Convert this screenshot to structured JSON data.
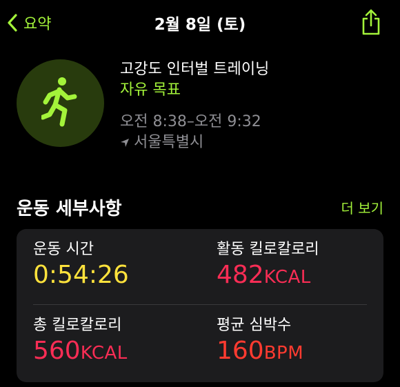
{
  "nav": {
    "back_label": "요약",
    "title": "2월 8일 (토)"
  },
  "workout": {
    "type": "고강도 인터벌 트레이닝",
    "goal": "자유 목표",
    "time_range": "오전 8:38–오전 9:32",
    "location": "서울특별시",
    "icon": "running-figure-icon"
  },
  "details": {
    "title": "운동 세부사항",
    "show_more": "더 보기",
    "metrics": [
      {
        "label": "운동 시간",
        "value": "0:54:26",
        "unit": "",
        "color": "#ffe23c"
      },
      {
        "label": "활동 킬로칼로리",
        "value": "482",
        "unit": "KCAL",
        "color": "#fa2d55"
      },
      {
        "label": "총 킬로칼로리",
        "value": "560",
        "unit": "KCAL",
        "color": "#fa2d55"
      },
      {
        "label": "평균 심박수",
        "value": "160",
        "unit": "BPM",
        "color": "#ff3b30"
      }
    ]
  },
  "colors": {
    "accent": "#a3f33a",
    "background": "#000000",
    "card": "#1c1c1e",
    "secondary_text": "#8e8e93"
  }
}
